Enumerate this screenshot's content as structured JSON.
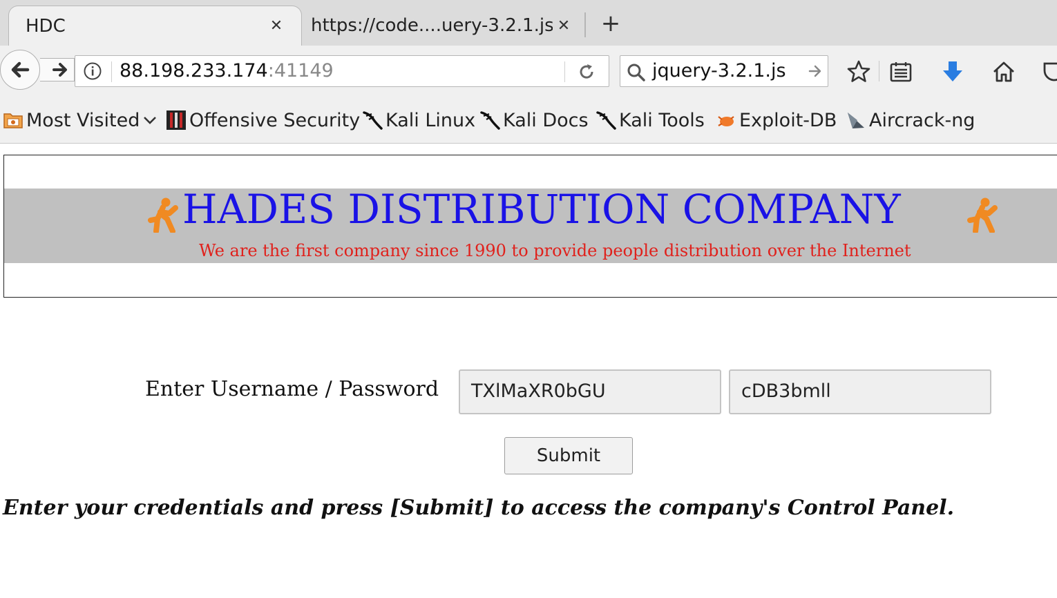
{
  "browser": {
    "tabs": [
      {
        "title": "HDC",
        "active": true
      },
      {
        "title": "https://code....uery-3.2.1.js",
        "active": false
      }
    ],
    "address": {
      "host": "88.198.233.174",
      "port": ":41149"
    },
    "search": {
      "value": "jquery-3.2.1.js"
    },
    "toolbar_icons": [
      "star-icon",
      "reader-list-icon",
      "download-icon",
      "home-icon",
      "pocket-icon"
    ],
    "accent_download": "#2a7de1",
    "bookmarks": [
      {
        "label": "Most Visited",
        "icon": "folder-icon"
      },
      {
        "label": "Offensive Security",
        "icon": "offsec-icon"
      },
      {
        "label": "Kali Linux",
        "icon": "kali-dragon-icon"
      },
      {
        "label": "Kali Docs",
        "icon": "kali-dragon-icon"
      },
      {
        "label": "Kali Tools",
        "icon": "kali-dragon-icon"
      },
      {
        "label": "Exploit-DB",
        "icon": "exploitdb-icon"
      },
      {
        "label": "Aircrack-ng",
        "icon": "aircrack-icon"
      }
    ]
  },
  "page": {
    "brand": {
      "title": "HADES DISTRIBUTION COMPANY",
      "subtitle": "We are the first company since 1990 to provide people distribution over the Internet",
      "title_color": "#1a12e6",
      "subtitle_color": "#e0211c",
      "band_color": "#c0c0c0"
    },
    "login": {
      "label": "Enter Username / Password",
      "username_value": "TXlMaXR0bGU",
      "password_value": "cDB3bmll",
      "submit_label": "Submit"
    },
    "instruction": "Enter your credentials and press [Submit] to access the company's Control Panel."
  }
}
